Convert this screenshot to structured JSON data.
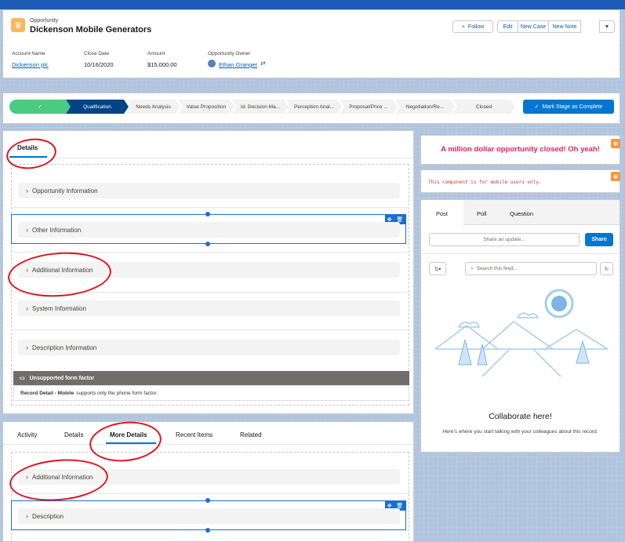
{
  "header": {
    "object_type": "Opportunity",
    "title": "Dickenson Mobile Generators",
    "buttons": {
      "follow": "Follow",
      "edit": "Edit",
      "new_case": "New Case",
      "new_note": "New Note"
    },
    "fields": {
      "account_name_label": "Account Name",
      "account_name_value": "Dickenson plc",
      "close_date_label": "Close Date",
      "close_date_value": "10/16/2020",
      "amount_label": "Amount",
      "amount_value": "$15,000.00",
      "owner_label": "Opportunity Owner",
      "owner_value": "Ethan Granger"
    }
  },
  "path": {
    "stages": [
      "✓",
      "Qualification",
      "Needs Analysis",
      "Value Proposition",
      "Id. Decision Ma...",
      "Perception Anal...",
      "Proposal/Price ...",
      "Negotiation/Re...",
      "Closed"
    ],
    "mark_complete_label": "Mark Stage as Complete"
  },
  "details": {
    "tab_label": "Details",
    "sections": [
      "Opportunity Information",
      "Other Information",
      "Additional Information",
      "System Information",
      "Description Information"
    ],
    "warning_title": "Unsupported form factor",
    "warning_bold": "Record Detail - Mobile",
    "warning_text": "supports only the phone form factor."
  },
  "more": {
    "tabs": [
      "Activity",
      "Details",
      "More Details",
      "Recent Items",
      "Related"
    ],
    "active_tab": "More Details",
    "sections": [
      "Additional Information",
      "Description"
    ]
  },
  "banner": {
    "text": "A million dollar opportunity closed! Oh yeah!",
    "color": "#e0245e"
  },
  "mobile_note": {
    "text": "This component is for mobile users only."
  },
  "feed": {
    "tabs": [
      "Post",
      "Poll",
      "Question"
    ],
    "share_placeholder": "Share an update...",
    "share_label": "Share",
    "search_placeholder": "Search this feed...",
    "empty_title": "Collaborate here!",
    "empty_text": "Here's where you start talking with your colleagues about this record."
  },
  "colors": {
    "brand": "#0176d3",
    "path_done": "#4bca81",
    "path_current": "#014486",
    "annotation_red": "#e0141e"
  }
}
